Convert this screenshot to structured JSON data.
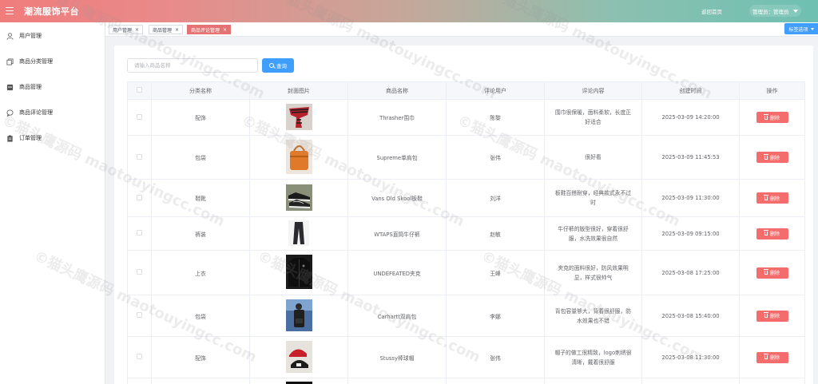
{
  "header": {
    "title": "潮流服饰平台",
    "home_link": "返回首页",
    "admin_label": "管理员：管理员"
  },
  "sidebar": {
    "items": [
      {
        "label": "用户管理",
        "icon": "user-icon"
      },
      {
        "label": "商品分类管理",
        "icon": "copy-icon"
      },
      {
        "label": "商品管理",
        "icon": "goods-icon"
      },
      {
        "label": "商品评论管理",
        "icon": "chat-icon"
      },
      {
        "label": "订单管理",
        "icon": "clipboard-icon"
      }
    ]
  },
  "tabs": [
    {
      "label": "用户管理",
      "active": false
    },
    {
      "label": "商品管理",
      "active": false
    },
    {
      "label": "商品评论管理",
      "active": true
    }
  ],
  "tab_options_label": "标签选项",
  "search": {
    "placeholder": "请输入商品名称",
    "button_label": "查询"
  },
  "table": {
    "columns": [
      "分类名称",
      "封面图片",
      "商品名称",
      "评论用户",
      "评论内容",
      "创建时间",
      "操作"
    ],
    "delete_label": "删除",
    "rows": [
      {
        "category": "配饰",
        "product": "Thrasher围巾",
        "user": "陈黎",
        "comment": "围巾很保暖，面料柔软，长度正好适合",
        "time": "2025-03-09 14:20:00",
        "cover": "scarf"
      },
      {
        "category": "包袋",
        "product": "Supreme单肩包",
        "user": "张伟",
        "comment": "很好看",
        "time": "2025-03-09 11:45:53",
        "cover": "bag"
      },
      {
        "category": "鞋靴",
        "product": "Vans Old Skool板鞋",
        "user": "刘洋",
        "comment": "板鞋百搭耐穿，经典款式永不过时",
        "time": "2025-03-09 11:30:00",
        "cover": "shoes"
      },
      {
        "category": "裤装",
        "product": "WTAPS直筒牛仔裤",
        "user": "赵敏",
        "comment": "牛仔裤的版型很好，穿着很舒服，水洗效果很自然",
        "time": "2025-03-09 09:15:00",
        "cover": "jeans"
      },
      {
        "category": "上衣",
        "product": "UNDEFEATED夹克",
        "user": "王峰",
        "comment": "夹克的面料很好，防风效果明显，样式很帅气",
        "time": "2025-03-08 17:25:00",
        "cover": "jacket"
      },
      {
        "category": "包袋",
        "product": "Carhartt双肩包",
        "user": "李娜",
        "comment": "背包容量够大，背着很舒服，防水效果也不错",
        "time": "2025-03-08 15:40:00",
        "cover": "backpack"
      },
      {
        "category": "配饰",
        "product": "Stussy棒球帽",
        "user": "张伟",
        "comment": "帽子的做工很精致，logo刺绣很清晰，戴着很舒服",
        "time": "2025-03-08 11:30:00",
        "cover": "cap"
      }
    ]
  },
  "watermark": "©猫头鹰源码 maotouyingcc.com",
  "colors": {
    "accent": "#409eff",
    "danger": "#f56c6c",
    "active_tab": "#e57373",
    "header_left": "#f07c7c",
    "header_right": "#6fc0b2"
  }
}
